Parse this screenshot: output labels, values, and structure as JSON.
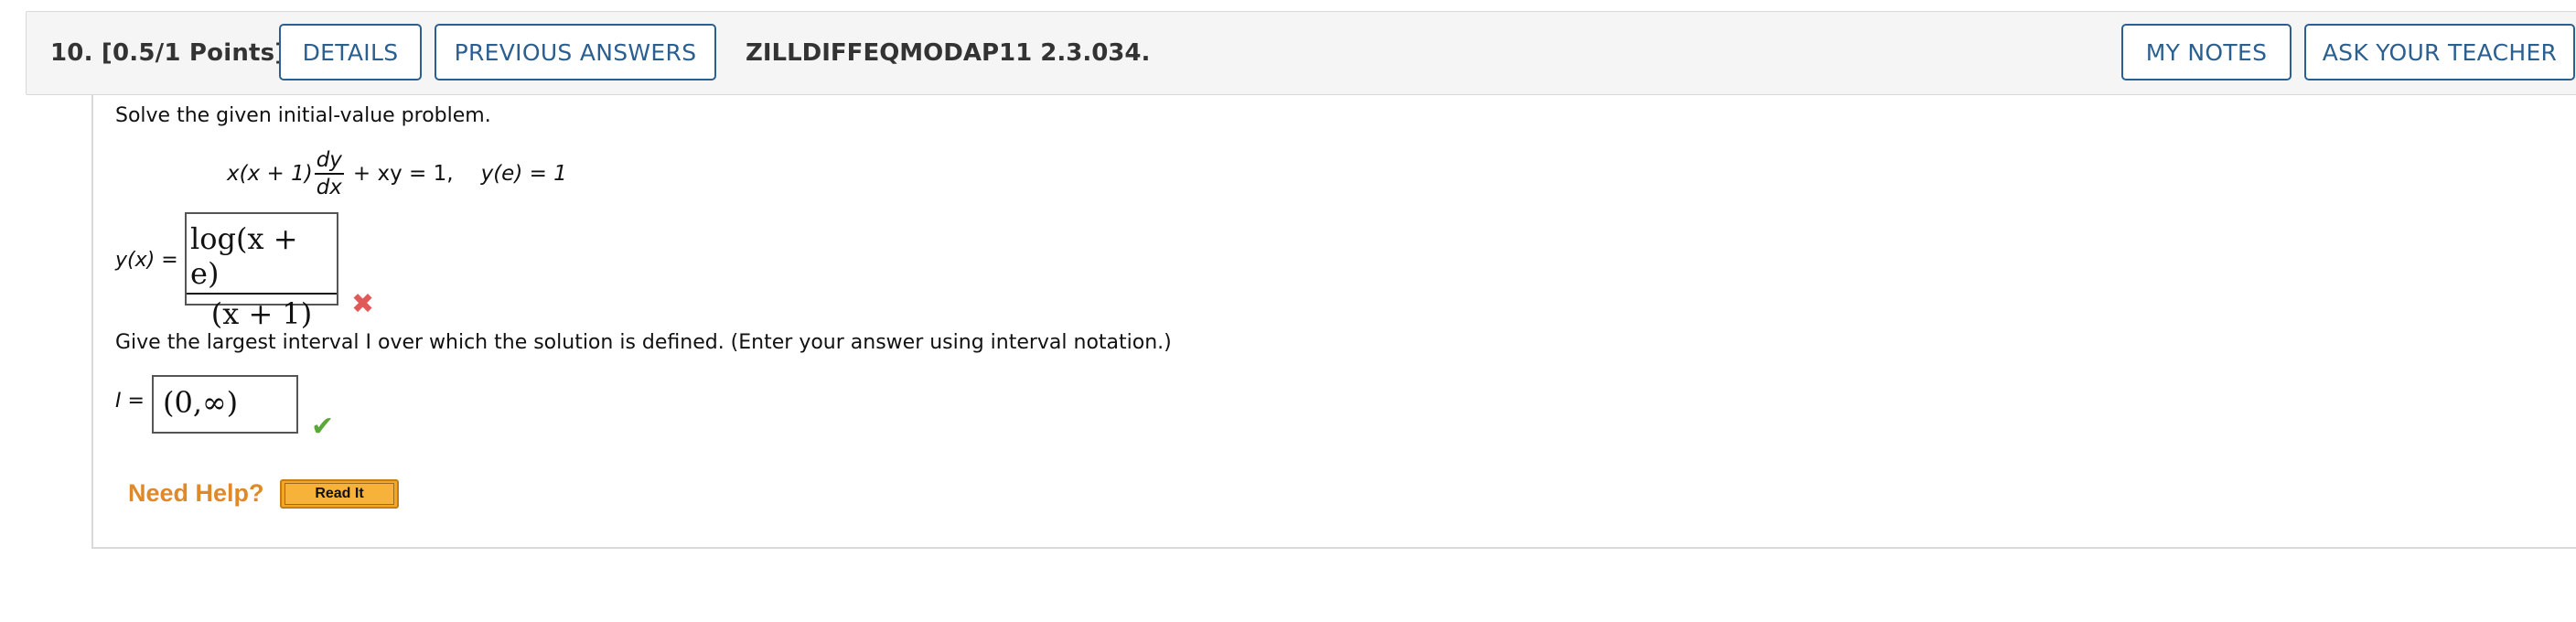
{
  "header": {
    "question_label": "10.  [0.5/1 Points]",
    "details_label": "DETAILS",
    "previous_answers_label": "PREVIOUS ANSWERS",
    "problem_code": "ZILLDIFFEQMODAP11 2.3.034.",
    "my_notes_label": "MY NOTES",
    "ask_teacher_label": "ASK YOUR TEACHER"
  },
  "question": {
    "prompt": "Solve the given initial-value problem.",
    "equation": {
      "lhs_prefix": "x(x + 1)",
      "frac_num": "dy",
      "frac_den": "dx",
      "rhs": "+ xy = 1,",
      "condition": "y(e) = 1"
    },
    "answer1": {
      "label": "y(x) =",
      "numerator": "log(x + e)",
      "denominator": "(x + 1)",
      "status": "incorrect"
    },
    "interval_prompt": "Give the largest interval I over which the solution is defined. (Enter your answer using interval notation.)",
    "answer2": {
      "label": "I =",
      "value": "(0,∞)",
      "status": "correct"
    }
  },
  "help": {
    "need_help_label": "Need Help?",
    "read_it_label": "Read It"
  },
  "colors": {
    "button_accent": "#2a5f8f",
    "incorrect": "#e05a5a",
    "correct": "#5aa83a",
    "help_text": "#e0892a",
    "read_it_bg": "#f5a623"
  }
}
